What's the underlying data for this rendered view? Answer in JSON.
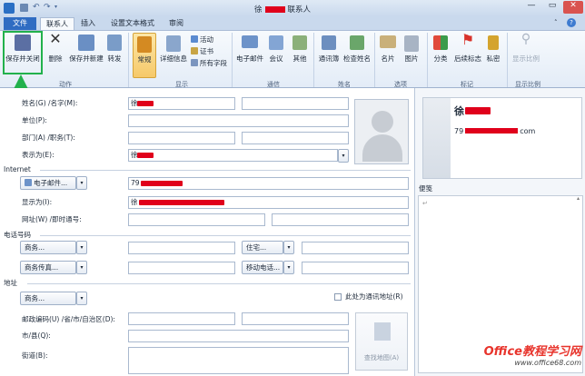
{
  "window": {
    "title_prefix": "徐",
    "title_suffix": "联系人"
  },
  "tabs": {
    "file": "文件",
    "contact": "联系人",
    "insert": "插入",
    "format_text": "设置文本格式",
    "review": "审阅"
  },
  "ribbon": {
    "actions": {
      "save_close": "保存并关闭",
      "delete": "删除",
      "save_new": "保存并新建",
      "forward": "转发",
      "group": "动作"
    },
    "show": {
      "general": "常规",
      "details": "详细信息",
      "activities": "活动",
      "certificates": "证书",
      "all_fields": "所有字段",
      "group": "显示"
    },
    "communicate": {
      "email": "电子邮件",
      "meeting": "会议",
      "more": "其他",
      "group": "通信"
    },
    "names": {
      "address_book": "通讯簿",
      "check_names": "检查姓名",
      "group": "姓名"
    },
    "options": {
      "card": "名片",
      "picture": "图片",
      "group": "选项"
    },
    "tags": {
      "categorize": "分类",
      "follow_up": "后续标志",
      "private": "私密",
      "group": "标记"
    },
    "zoom": {
      "zoom": "显示比例",
      "group": "显示比例"
    }
  },
  "form": {
    "full_name": "姓名(G) /名字(M):",
    "company": "单位(P):",
    "dept": "部门(A) /职务(T):",
    "file_as": "表示为(E):",
    "file_as_value": "徐",
    "internet_section": "Internet",
    "email_btn": "电子邮件...",
    "email_value": "79",
    "display_as": "显示为(I):",
    "display_value": "徐",
    "web": "网址(W) /即时通号:",
    "phone_section": "电话号码",
    "business": "商务...",
    "home": "住宅...",
    "business_fax": "商务传真...",
    "mobile": "移动电话...",
    "address_section": "地址",
    "address_business": "商务...",
    "mailing_checkbox": "此处为通讯地址(R)",
    "postal": "邮政编码(U) /省/市/自治区(D):",
    "city": "市/县(Q):",
    "street": "街道(B):",
    "map": "查找地图(A)",
    "name_value": "徐"
  },
  "card": {
    "name": "徐",
    "email_prefix": "79",
    "email_suffix": "com"
  },
  "notes": {
    "label": "便笺",
    "mark": "↵"
  },
  "watermark": {
    "brand": "Office教程学习网",
    "url": "www.office68.com"
  }
}
